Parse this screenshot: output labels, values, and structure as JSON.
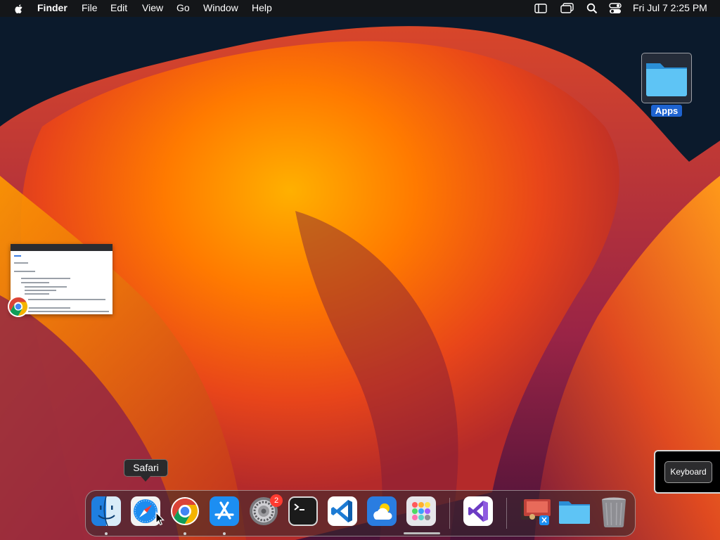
{
  "menubar": {
    "app_name": "Finder",
    "menus": [
      "File",
      "Edit",
      "View",
      "Go",
      "Window",
      "Help"
    ],
    "status_icons": [
      "sidebar-icon",
      "window-switcher-icon",
      "spotlight-icon",
      "control-center-icon"
    ],
    "clock": "Fri Jul 7  2:25 PM"
  },
  "desktop": {
    "folder_label": "Apps",
    "preview_app": "Google Chrome"
  },
  "tooltip": {
    "label": "Safari"
  },
  "keyboard": {
    "label": "Keyboard"
  },
  "dock": {
    "items": [
      {
        "name": "Finder",
        "icon": "finder-icon",
        "running": true
      },
      {
        "name": "Safari",
        "icon": "safari-icon",
        "running": false
      },
      {
        "name": "Google Chrome",
        "icon": "chrome-icon",
        "running": true
      },
      {
        "name": "App Store",
        "icon": "app-store-icon",
        "running": true
      },
      {
        "name": "System Settings",
        "icon": "system-settings-icon",
        "running": false,
        "badge": "2"
      },
      {
        "name": "Terminal",
        "icon": "terminal-icon",
        "running": false
      },
      {
        "name": "Visual Studio Code",
        "icon": "vscode-icon",
        "running": false
      },
      {
        "name": "Weather",
        "icon": "weather-icon",
        "running": false
      },
      {
        "name": "Launchpad",
        "icon": "launchpad-icon",
        "running": false
      },
      {
        "name": "Visual Studio",
        "icon": "visual-studio-icon",
        "running": false
      },
      {
        "name": "Downloads",
        "icon": "stack-icon",
        "running": false
      },
      {
        "name": "Folder",
        "icon": "folder-icon",
        "running": false
      },
      {
        "name": "Trash",
        "icon": "trash-icon",
        "running": false
      }
    ],
    "badge": "2"
  },
  "colors": {
    "accent": "#1e63d0",
    "badge_red": "#ff3b30",
    "wallpaper_orange": "#ff7a00",
    "wallpaper_magenta": "#8a1e4a",
    "wallpaper_navy": "#0b1a2c"
  }
}
